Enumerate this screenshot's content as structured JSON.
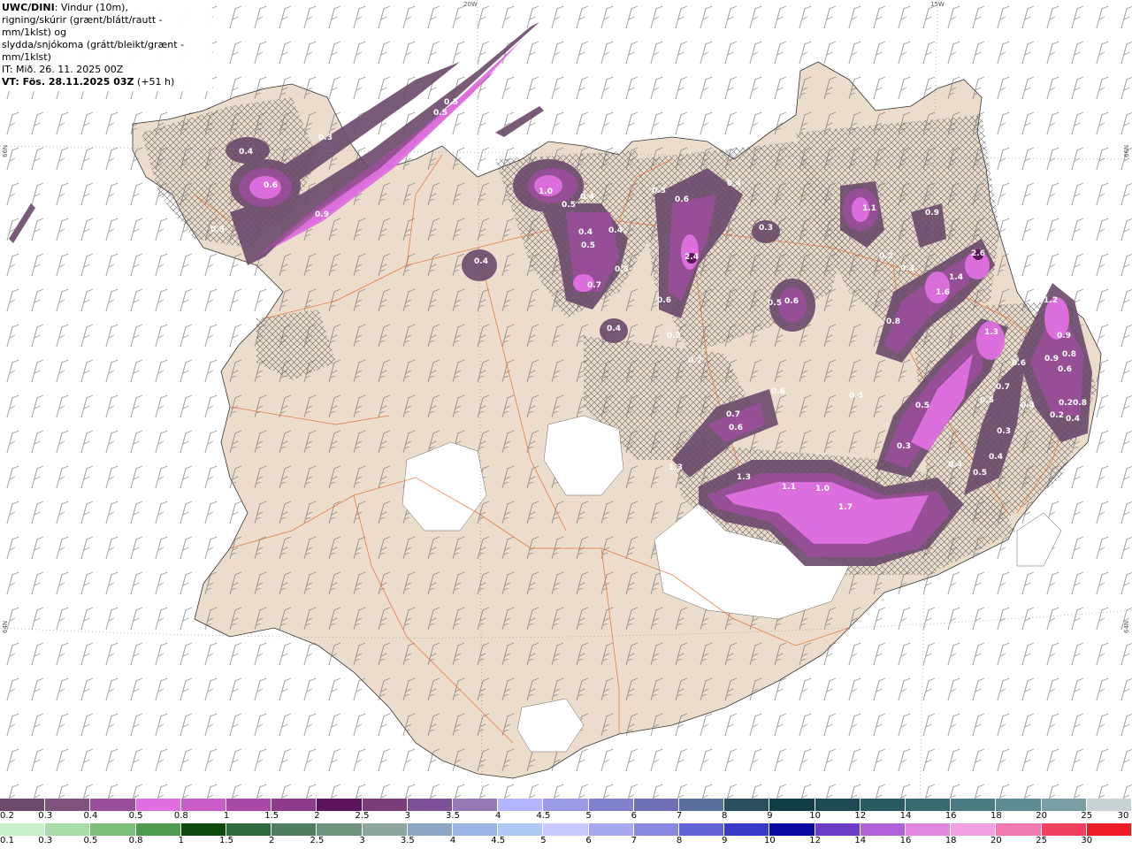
{
  "info": {
    "line1_bold": "UWC/DINI",
    "line1_rest": ": Vindur (10m),",
    "line2": "rigning/skúrir (grænt/blátt/rautt - mm/1klst) og",
    "line3": "slydda/snjókoma (grátt/bleikt/grænt - mm/1klst)",
    "line4": "IT: Mið. 26. 11. 2025 00Z",
    "line5_bold": "VT: Fös. 28.11.2025 03Z",
    "line5_rest": " (+51 h)"
  },
  "grid_labels": {
    "top_left": "20W",
    "top_right": "15W",
    "left_top": "66N",
    "right_top": "66N",
    "left_bottom": "64N",
    "right_bottom": "64N"
  },
  "precip_values": [
    "0.4",
    "0.6",
    "0.3",
    "0.5",
    "0.3",
    "0.3",
    "0.9",
    "0.5",
    "0.5",
    "0.4",
    "1.0",
    "0.5",
    "0.4",
    "0.4",
    "0.5",
    "0.4",
    "0.5",
    "0.7",
    "0.3",
    "0.6",
    "0.4",
    "2.4",
    "0.6",
    "0.2",
    "0.3",
    "0.5",
    "0.6",
    "0.4",
    "0.2",
    "1.1",
    "0.9",
    "0.2",
    "0.3",
    "2.6",
    "1.4",
    "1.6",
    "0.8",
    "1.3",
    "1.2",
    "0.9",
    "0.6",
    "0.8",
    "0.9",
    "0.6",
    "0.7",
    "0.4",
    "0.5",
    "0.5",
    "0.4",
    "0.2",
    "0.8",
    "0.4",
    "0.2",
    "0.3",
    "0.4",
    "0.5",
    "0.4",
    "0.3",
    "0.6",
    "0.7",
    "0.6",
    "1.3",
    "1.3",
    "1.1",
    "1.0",
    "1.7"
  ],
  "legend_snow": {
    "labels": [
      "0.2",
      "0.3",
      "0.4",
      "0.5",
      "0.8",
      "1",
      "1.5",
      "2",
      "2.5",
      "3",
      "3.5",
      "4",
      "4.5",
      "5",
      "6",
      "7",
      "8",
      "9",
      "10",
      "12",
      "14",
      "16",
      "18",
      "20",
      "25",
      "30"
    ],
    "colors": [
      "#6b4a6b",
      "#7d537d",
      "#9a4f9a",
      "#e070e0",
      "#c95ec9",
      "#a94aa9",
      "#8e3b8e",
      "#5c155c",
      "#7a3d7a",
      "#7d5197",
      "#9479b4",
      "#b3b3ff",
      "#9a9ae6",
      "#8080cc",
      "#6f6fb6",
      "#5a6f9e",
      "#2a4f5f",
      "#113d46",
      "#1d4a55",
      "#2a5a64",
      "#386a72",
      "#4a7a82",
      "#5e8a91",
      "#7a9ea3",
      "#c8d2d4"
    ]
  },
  "legend_rain": {
    "labels": [
      "0.1",
      "0.3",
      "0.5",
      "0.8",
      "1",
      "1.5",
      "2",
      "2.5",
      "3",
      "3.5",
      "4",
      "4.5",
      "5",
      "6",
      "7",
      "8",
      "9",
      "10",
      "12",
      "14",
      "16",
      "18",
      "20",
      "25",
      "30"
    ],
    "colors": [
      "#c8f0c8",
      "#a8dca8",
      "#7cc07c",
      "#4e9a4e",
      "#0e4a0e",
      "#2e6a3e",
      "#4e7e5e",
      "#6e927e",
      "#8ea69e",
      "#8ea6c6",
      "#9ab4e4",
      "#b0c8f6",
      "#c8c8ff",
      "#a8a8f0",
      "#8888e0",
      "#6464d8",
      "#3a3ac8",
      "#0a0aa0",
      "#6c3cc8",
      "#b060d8",
      "#e088e0",
      "#f0a0e0",
      "#f07ab0",
      "#f04060",
      "#ee1c24"
    ]
  }
}
